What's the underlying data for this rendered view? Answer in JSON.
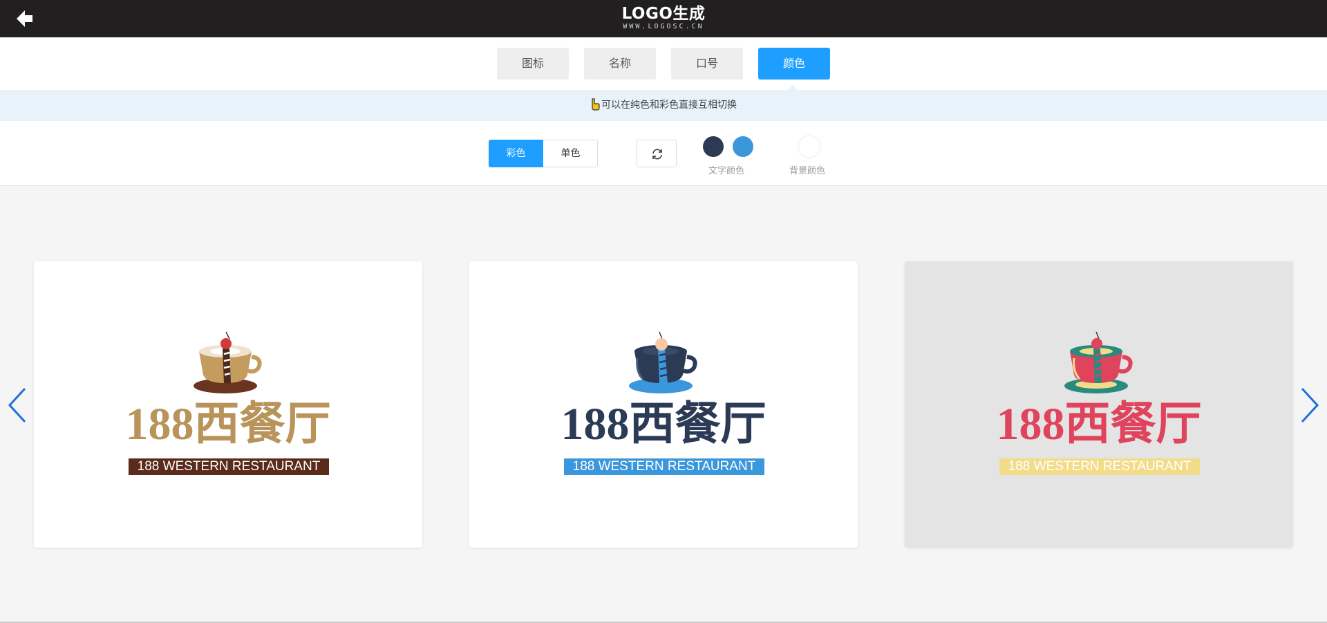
{
  "header": {
    "title": "LOGO生成",
    "subtitle": "WWW.LOGOSC.CN",
    "bg_color": "#221f20",
    "back_icon": "back-arrow-icon"
  },
  "tabs": [
    {
      "label": "图标",
      "active": false
    },
    {
      "label": "名称",
      "active": false
    },
    {
      "label": "口号",
      "active": false
    },
    {
      "label": "颜色",
      "active": true
    }
  ],
  "tip": {
    "icon": "pointing-hand-icon",
    "text": "可以在纯色和彩色直接互相切换"
  },
  "controls": {
    "color_mode": {
      "options": [
        "彩色",
        "单色"
      ],
      "selected": "彩色"
    },
    "refresh_icon": "refresh-icon",
    "text_colors": [
      "#2b3a55",
      "#3a97db"
    ],
    "text_color_label": "文字颜色",
    "bg_color": "#ffffff",
    "bg_color_label": "背景颜色"
  },
  "accent_color": "#1e9fff",
  "cards": [
    {
      "name": "188西餐厅",
      "tagline": "188 WESTERN RESTAURANT",
      "name_color": "#b8935a",
      "tag_bg": "#5a2a1a",
      "tag_color": "#ffffff",
      "card_bg": "#ffffff"
    },
    {
      "name": "188西餐厅",
      "tagline": "188 WESTERN RESTAURANT",
      "name_color": "#2b3a55",
      "tag_bg": "#3a97db",
      "tag_color": "#ffffff",
      "card_bg": "#ffffff"
    },
    {
      "name": "188西餐厅",
      "tagline": "188 WESTERN RESTAURANT",
      "name_color": "#e0435c",
      "tag_bg": "#f2dc8a",
      "tag_color": "#ffffff",
      "card_bg": "#e4e4e4"
    }
  ],
  "nav": {
    "prev_icon": "chevron-left-icon",
    "next_icon": "chevron-right-icon"
  }
}
